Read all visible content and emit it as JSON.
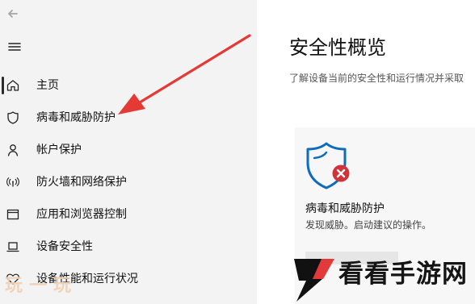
{
  "window": {
    "back_icon": "back-arrow-icon",
    "menu_icon": "hamburger-icon"
  },
  "sidebar": {
    "selected_index": 0,
    "items": [
      {
        "label": "主页",
        "icon": "home-icon"
      },
      {
        "label": "病毒和威胁防护",
        "icon": "shield-icon"
      },
      {
        "label": "帐户保护",
        "icon": "person-icon"
      },
      {
        "label": "防火墙和网络保护",
        "icon": "wireless-icon"
      },
      {
        "label": "应用和浏览器控制",
        "icon": "browser-window-icon"
      },
      {
        "label": "设备安全性",
        "icon": "laptop-icon"
      },
      {
        "label": "设备性能和运行状况",
        "icon": "heart-icon"
      }
    ]
  },
  "main": {
    "title": "安全性概览",
    "subtitle": "了解设备当前的安全性和运行情况并采取",
    "card": {
      "title": "病毒和威胁防护",
      "description": "发现威胁。启动建议的操作。",
      "icon": "shield-warning-icon",
      "status_icon": "error-icon"
    }
  },
  "colors": {
    "sidebar_bg": "#f3f3f3",
    "accent_blue": "#0f6cbd",
    "error_red": "#d13438",
    "annotation_red": "#e53935",
    "text_primary": "#111111"
  },
  "annotation": {
    "icon": "red-arrow-icon"
  },
  "watermarks": {
    "left_text": "玩一玩",
    "brand_text": "看看手游网",
    "brand_icon": "brand-logo-icon"
  }
}
